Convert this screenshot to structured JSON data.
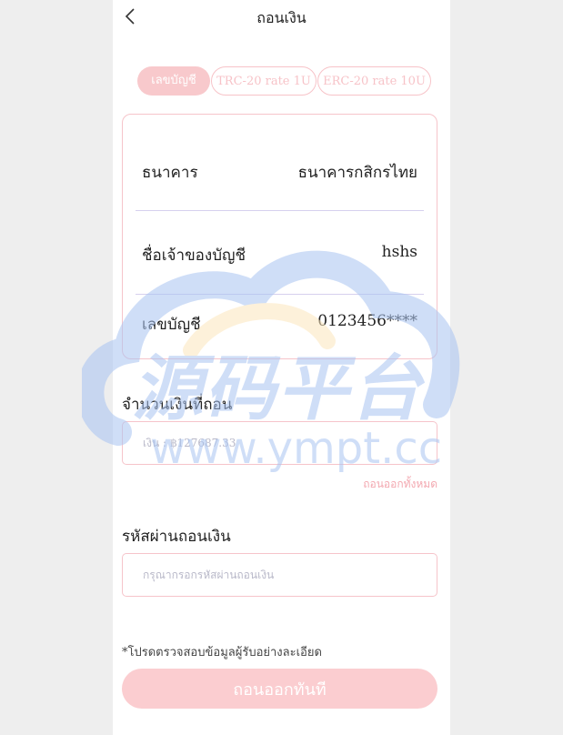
{
  "header": {
    "title": "ถอนเงิน"
  },
  "tabs": [
    {
      "label": "เลขบัญชี",
      "active": true
    },
    {
      "label": "TRC-20 rate 1U",
      "active": false
    },
    {
      "label": "ERC-20 rate 10U",
      "active": false
    }
  ],
  "bank_card": {
    "rows": [
      {
        "label": "ธนาคาร",
        "value": "ธนาคารกสิกรไทย"
      },
      {
        "label": "ชื่อเจ้าของบัญชี",
        "value": "hshs"
      },
      {
        "label": "เลขบัญชี",
        "value": "0123456****"
      }
    ]
  },
  "amount": {
    "label": "จำนวนเงินที่ถอน",
    "placeholder": "เงิน : ฿127687.33",
    "withdraw_all": "ถอนออกทั้งหมด"
  },
  "password": {
    "label": "รหัสผ่านถอนเงิน",
    "placeholder": "กรุณากรอกรหัสผ่านถอนเงิน"
  },
  "note": "*โปรดตรวจสอบข้อมูลผู้รับอย่างละเอียด",
  "submit_label": "ถอนออกทันที",
  "watermark": {
    "text_big": "源码平台",
    "text_small": "www.ympt.cc"
  },
  "colors": {
    "accent_pink": "#f8c9cc",
    "border_pink": "#f6c4ca",
    "divider": "#d6d0ee",
    "watermark_blue": "#a9c4f2",
    "watermark_yellow": "#fde7bd"
  }
}
